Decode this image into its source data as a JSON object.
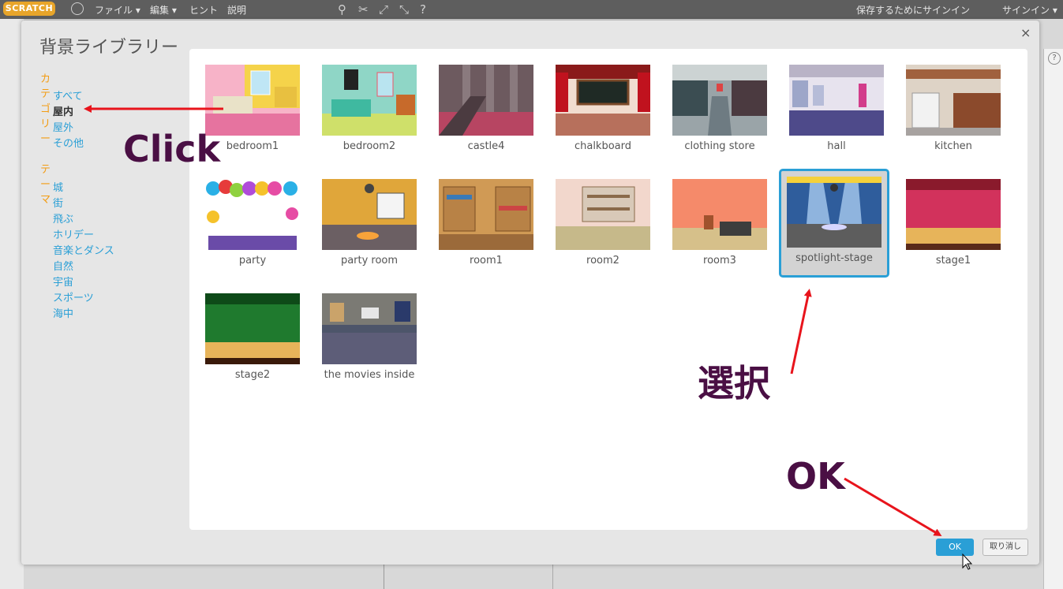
{
  "menubar": {
    "logo": "SCRATCH",
    "file": "ファイル ▾",
    "edit": "編集 ▾",
    "tips": "ヒント",
    "about": "説明",
    "sign_in_to_save": "保存するためにサインイン",
    "sign_in": "サインイン ▾"
  },
  "dialog": {
    "title": "背景ライブラリー",
    "close": "×",
    "ok": "OK",
    "cancel": "取り消し"
  },
  "categories": {
    "heading": "カテゴリー",
    "items": [
      "すべて",
      "屋内",
      "屋外",
      "その他"
    ],
    "active": "屋内"
  },
  "themes": {
    "heading": "テーマ",
    "items": [
      "城",
      "街",
      "飛ぶ",
      "ホリデー",
      "音楽とダンス",
      "自然",
      "宇宙",
      "スポーツ",
      "海中"
    ]
  },
  "backdrops": [
    {
      "label": "bedroom1"
    },
    {
      "label": "bedroom2"
    },
    {
      "label": "castle4"
    },
    {
      "label": "chalkboard"
    },
    {
      "label": "clothing store"
    },
    {
      "label": "hall"
    },
    {
      "label": "kitchen"
    },
    {
      "label": "party"
    },
    {
      "label": "party room"
    },
    {
      "label": "room1"
    },
    {
      "label": "room2"
    },
    {
      "label": "room3"
    },
    {
      "label": "spotlight-stage",
      "selected": true
    },
    {
      "label": "stage1"
    },
    {
      "label": "stage2"
    },
    {
      "label": "the movies inside"
    }
  ],
  "annotations": {
    "click": "Click",
    "select": "選択",
    "ok": "OK",
    "color": "#4a0f44",
    "arrow_color": "#e8141c"
  },
  "colors": {
    "accent": "#2a9fd6",
    "category_heading": "#f39c12"
  }
}
